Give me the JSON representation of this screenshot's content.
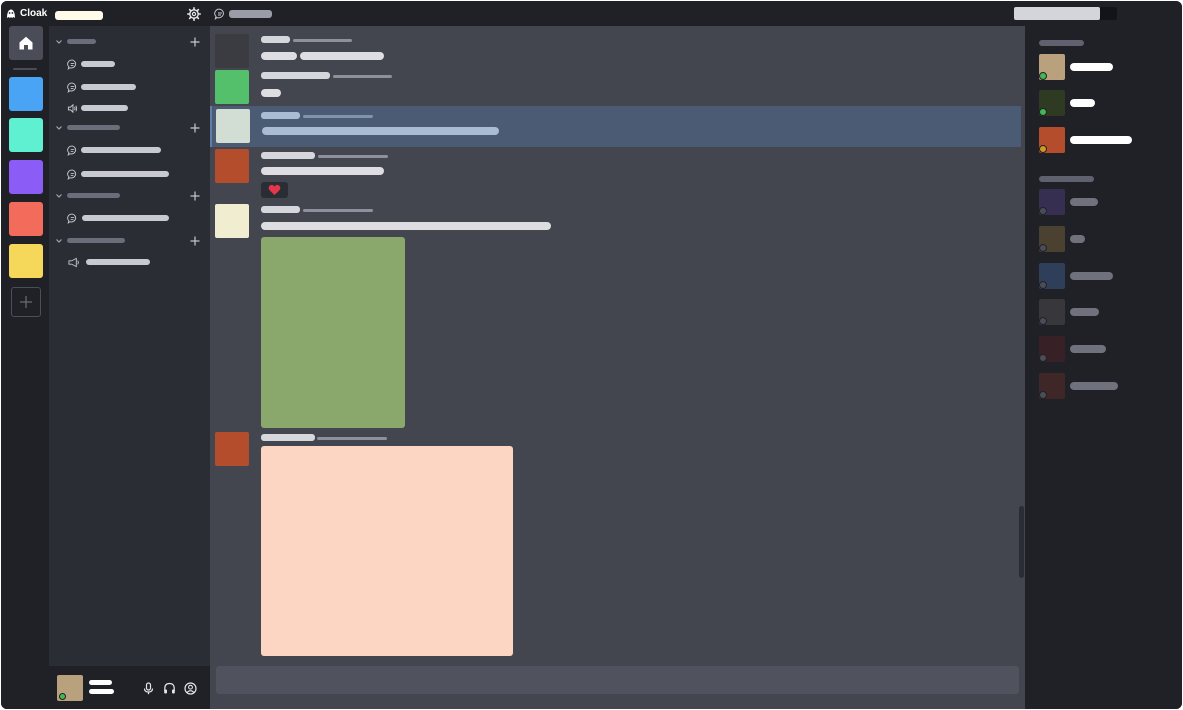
{
  "app": {
    "name": "Cloak"
  },
  "colors": {
    "rail_bg": "#202126",
    "sidebar_bg": "#2b2d34",
    "chat_bg": "#43454f",
    "highlight_bg": "#4a5b73",
    "online": "#3fb950",
    "idle": "#d29922",
    "offline": "#4a4d58"
  },
  "servers": [
    {
      "name": "home",
      "icon": "home-icon",
      "color": "#4a4d58"
    },
    {
      "name": "server-blue",
      "color": "#4aa4f5"
    },
    {
      "name": "server-teal",
      "color": "#5ff0d2"
    },
    {
      "name": "server-purple",
      "color": "#8b5cf6"
    },
    {
      "name": "server-coral",
      "color": "#f26b5b"
    },
    {
      "name": "server-yellow",
      "color": "#f5d75a"
    }
  ],
  "channel_sidebar": {
    "categories": [
      {
        "channels": [
          {
            "type": "text"
          },
          {
            "type": "text"
          },
          {
            "type": "voice"
          }
        ]
      },
      {
        "channels": [
          {
            "type": "text"
          },
          {
            "type": "text"
          }
        ]
      },
      {
        "channels": [
          {
            "type": "text"
          }
        ]
      },
      {
        "channels": [
          {
            "type": "voice"
          }
        ]
      }
    ]
  },
  "user_panel": {
    "avatar_color": "#b9a17d",
    "status": "online",
    "controls": [
      "microphone-icon",
      "headphones-icon",
      "user-settings-icon"
    ]
  },
  "messages": [
    {
      "avatar_color": "#3b3c42",
      "highlighted": false
    },
    {
      "avatar_color": "#55c06b",
      "highlighted": false
    },
    {
      "avatar_color": "#d2ddd4",
      "highlighted": true
    },
    {
      "avatar_color": "#b44d2c",
      "highlighted": false,
      "reaction": "heart-icon"
    },
    {
      "avatar_color": "#f1edd0",
      "highlighted": false,
      "attachment_color": "#8aa86c"
    },
    {
      "avatar_color": "#b44d2c",
      "highlighted": false,
      "attachment_color": "#fdd6c3"
    }
  ],
  "member_list": {
    "online": [
      {
        "avatar_color": "#b9a17d",
        "status": "online"
      },
      {
        "avatar_color": "#2e3a22",
        "status": "online"
      },
      {
        "avatar_color": "#b44d2c",
        "status": "idle"
      }
    ],
    "offline": [
      {
        "avatar_color": "#4b3d76",
        "status": "offline"
      },
      {
        "avatar_color": "#6e5c3b",
        "status": "offline"
      },
      {
        "avatar_color": "#3c5a83",
        "status": "offline"
      },
      {
        "avatar_color": "#4a4a4f",
        "status": "offline"
      },
      {
        "avatar_color": "#4a2327",
        "status": "offline"
      },
      {
        "avatar_color": "#5a2e2a",
        "status": "offline"
      }
    ]
  }
}
